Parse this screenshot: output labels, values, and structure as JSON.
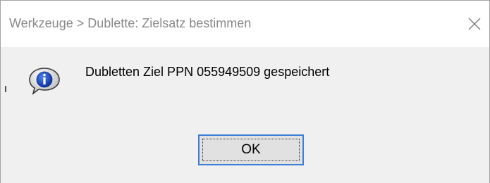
{
  "window": {
    "title": "Werkzeuge > Dublette: Zielsatz bestimmen",
    "close_icon": "close-icon"
  },
  "dialog": {
    "icon": "info-icon",
    "message": "Dubletten Ziel PPN 055949509 gespeichert",
    "ok_label": "OK"
  },
  "colors": {
    "titlebar_bg": "#ffffff",
    "body_bg": "#f0f0f0",
    "button_border_focus": "#3c7fd6",
    "info_blue": "#1a4ec8"
  }
}
